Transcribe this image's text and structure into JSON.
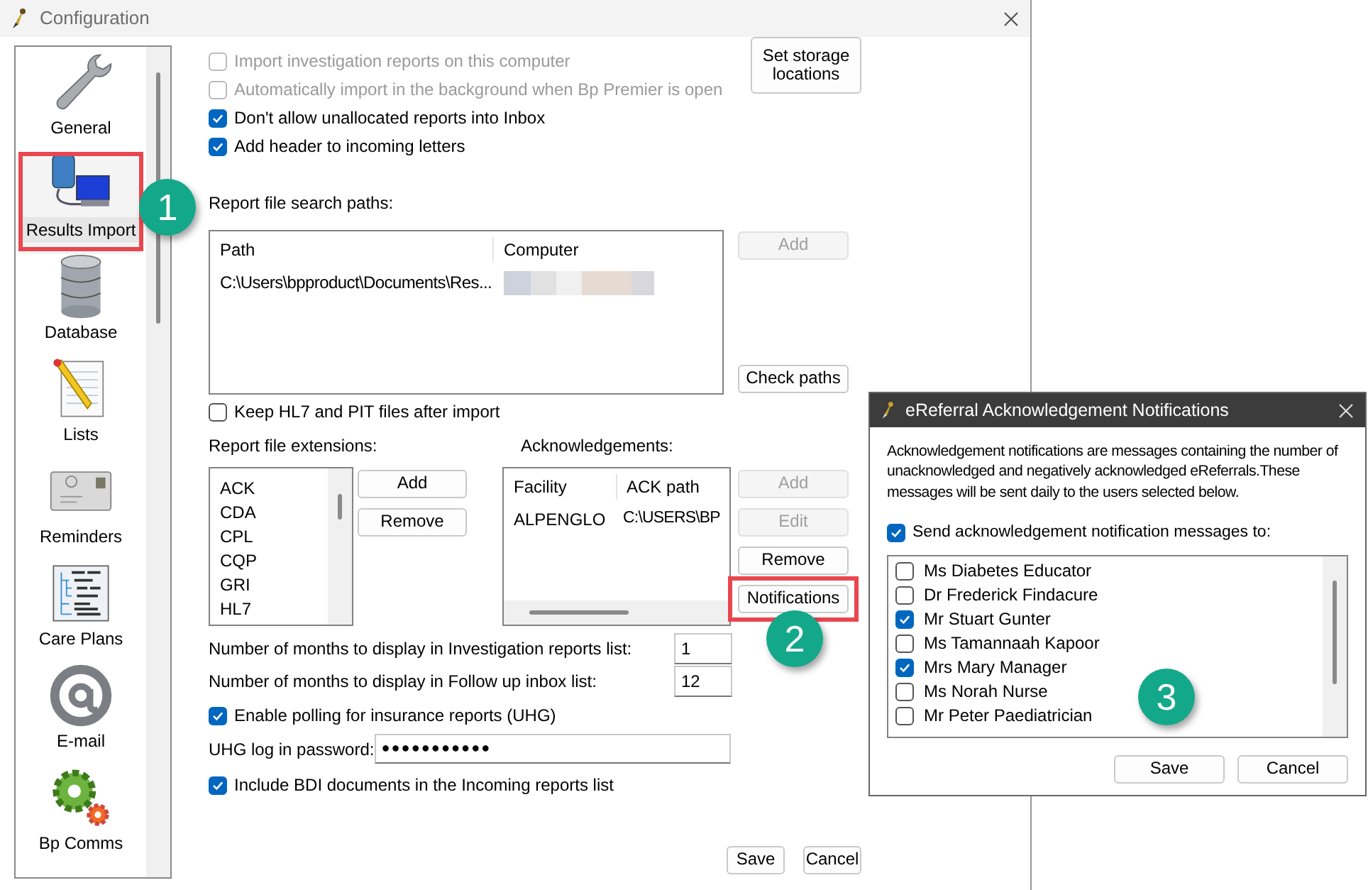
{
  "window": {
    "title": "Configuration"
  },
  "sidebar": {
    "items": [
      {
        "label": "General",
        "selected": false,
        "highlighted": false
      },
      {
        "label": "Results Import",
        "selected": true,
        "highlighted": true
      },
      {
        "label": "Database",
        "selected": false,
        "highlighted": false
      },
      {
        "label": "Lists",
        "selected": false,
        "highlighted": false
      },
      {
        "label": "Reminders",
        "selected": false,
        "highlighted": false
      },
      {
        "label": "Care Plans",
        "selected": false,
        "highlighted": false
      },
      {
        "label": "E-mail",
        "selected": false,
        "highlighted": false
      },
      {
        "label": "Bp Comms",
        "selected": false,
        "highlighted": false
      }
    ]
  },
  "options": [
    {
      "label": "Import investigation reports on this computer",
      "checked": false,
      "disabled": true
    },
    {
      "label": "Automatically import in the background when Bp Premier is open",
      "checked": false,
      "disabled": true
    },
    {
      "label": "Don't allow unallocated reports into Inbox",
      "checked": true,
      "disabled": false
    },
    {
      "label": "Add header to incoming letters",
      "checked": true,
      "disabled": false
    }
  ],
  "set_storage_button": {
    "label": "Set storage locations"
  },
  "search_paths": {
    "label": "Report file search paths:",
    "columns": [
      "Path",
      "Computer"
    ],
    "rows": [
      {
        "path": "C:\\Users\\bpproduct\\Documents\\Res..."
      }
    ],
    "buttons": [
      {
        "label": "Add",
        "disabled": true
      },
      {
        "label": "Check paths",
        "disabled": false
      }
    ]
  },
  "keep_files": {
    "label": "Keep HL7 and PIT files after import",
    "checked": false
  },
  "extensions": {
    "label": "Report file extensions:",
    "items": [
      "ACK",
      "CDA",
      "CPL",
      "CQP",
      "GRI",
      "HL7"
    ],
    "buttons": [
      {
        "label": "Add",
        "disabled": false
      },
      {
        "label": "Remove",
        "disabled": false
      }
    ]
  },
  "acknowledgements": {
    "label": "Acknowledgements:",
    "columns": [
      "Facility",
      "ACK path"
    ],
    "rows": [
      {
        "facility": "ALPENGLO",
        "ack_path": "C:\\USERS\\BP"
      }
    ],
    "buttons": [
      {
        "label": "Add",
        "disabled": true,
        "highlighted": false
      },
      {
        "label": "Edit",
        "disabled": true,
        "highlighted": false
      },
      {
        "label": "Remove",
        "disabled": false,
        "highlighted": false
      },
      {
        "label": "Notifications",
        "disabled": false,
        "highlighted": true
      }
    ]
  },
  "month_fields": [
    {
      "label": "Number of months to display in Investigation reports list:",
      "value": "1"
    },
    {
      "label": "Number of months to display in Follow up inbox list:",
      "value": "12"
    }
  ],
  "polling": {
    "label": "Enable polling for insurance reports (UHG)",
    "checked": true
  },
  "password": {
    "label": "UHG log in password:",
    "value": "●●●●●●●●●●●"
  },
  "bdi": {
    "label": "Include BDI documents in the Incoming reports list",
    "checked": true
  },
  "footer_buttons": [
    "Save",
    "Cancel"
  ],
  "dialog": {
    "title": "eReferral Acknowledgement Notifications",
    "description": "Acknowledgement notifications are messages containing the number of unacknowledged and negatively acknowledged eReferrals.These messages will be sent daily to the users selected below.",
    "send_to": {
      "label": "Send acknowledgement notification messages to:",
      "checked": true
    },
    "users": [
      {
        "name": "Ms Diabetes Educator",
        "checked": false
      },
      {
        "name": "Dr Frederick Findacure",
        "checked": false
      },
      {
        "name": "Mr Stuart Gunter",
        "checked": true
      },
      {
        "name": "Ms Tamannaah Kapoor",
        "checked": false
      },
      {
        "name": "Mrs Mary Manager",
        "checked": true
      },
      {
        "name": "Ms Norah Nurse",
        "checked": false
      },
      {
        "name": "Mr Peter Paediatrician",
        "checked": false
      }
    ],
    "buttons": [
      "Save",
      "Cancel"
    ]
  },
  "callouts": [
    "1",
    "2",
    "3"
  ]
}
